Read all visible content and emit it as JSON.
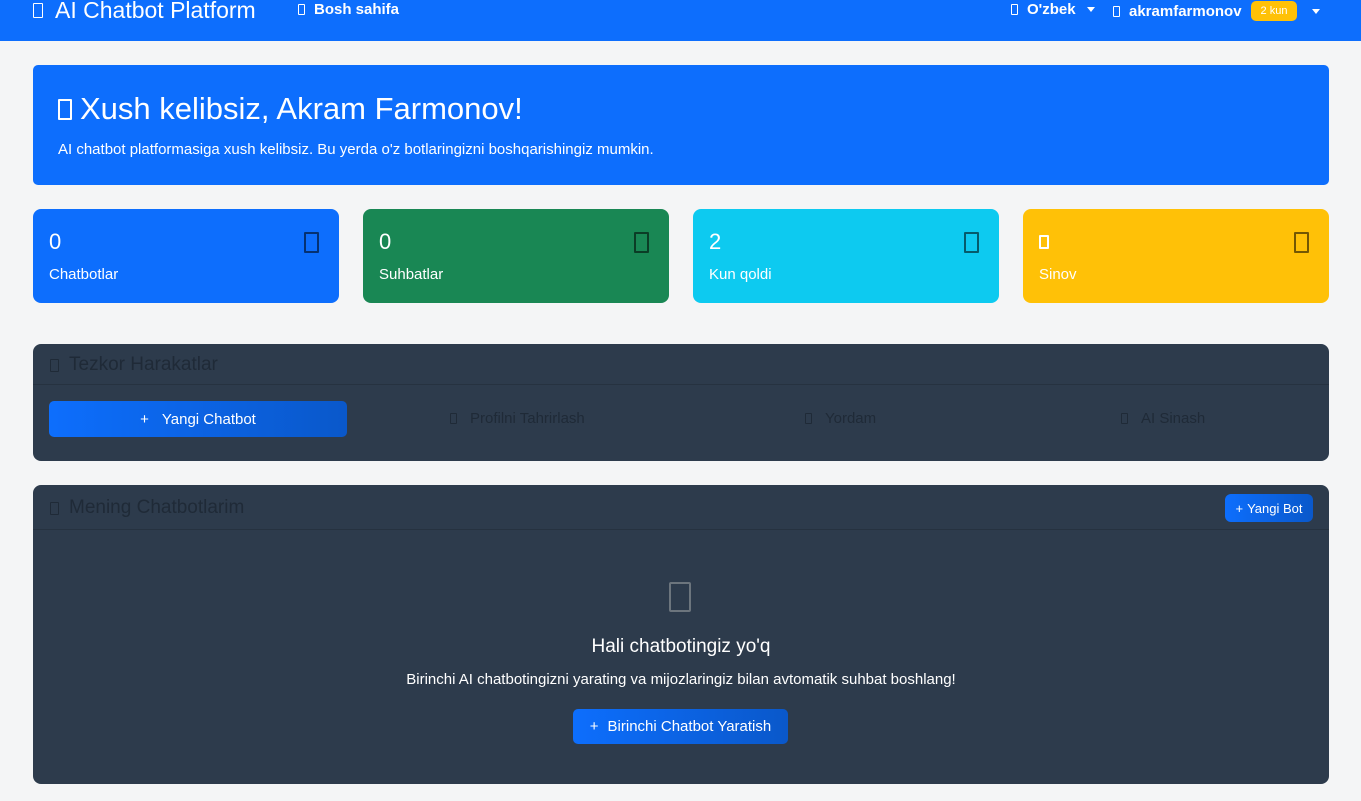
{
  "navbar": {
    "brand": "AI Chatbot Platform",
    "home_label": "Bosh sahifa",
    "language": "O'zbek",
    "username": "akramfarmonov",
    "trial_badge": "2 kun"
  },
  "hero": {
    "title": "Xush kelibsiz, Akram Farmonov!",
    "subtitle": "AI chatbot platformasiga xush kelibsiz. Bu yerda o'z botlaringizni boshqarishingiz mumkin."
  },
  "stats": [
    {
      "value": "0",
      "label": "Chatbotlar",
      "color": "#0d6efd",
      "icon": "robot-icon"
    },
    {
      "value": "0",
      "label": "Suhbatlar",
      "color": "#198754",
      "icon": "chat-icon"
    },
    {
      "value": "2",
      "label": "Kun qoldi",
      "color": "#0dcaf0",
      "icon": "calendar-icon"
    },
    {
      "value": "",
      "label": "Sinov",
      "color": "#ffc107",
      "icon": "crown-icon"
    }
  ],
  "quick_actions": {
    "title": "Tezkor Harakatlar",
    "new_chatbot": "Yangi Chatbot",
    "edit_profile": "Profilni Tahrirlash",
    "help": "Yordam",
    "ai_test": "AI Sinash"
  },
  "my_chatbots": {
    "title": "Mening Chatbotlarim",
    "new_bot_button": "Yangi Bot",
    "empty_title": "Hali chatbotingiz yo'q",
    "empty_subtitle": "Birinchi AI chatbotingizni yarating va mijozlaringiz bilan avtomatik suhbat boshlang!",
    "create_first_button": "Birinchi Chatbot Yaratish"
  },
  "colors": {
    "primary": "#0d6efd",
    "card_dark": "#2d3b4c",
    "warning": "#ffc107",
    "success": "#198754",
    "info": "#0dcaf0"
  }
}
